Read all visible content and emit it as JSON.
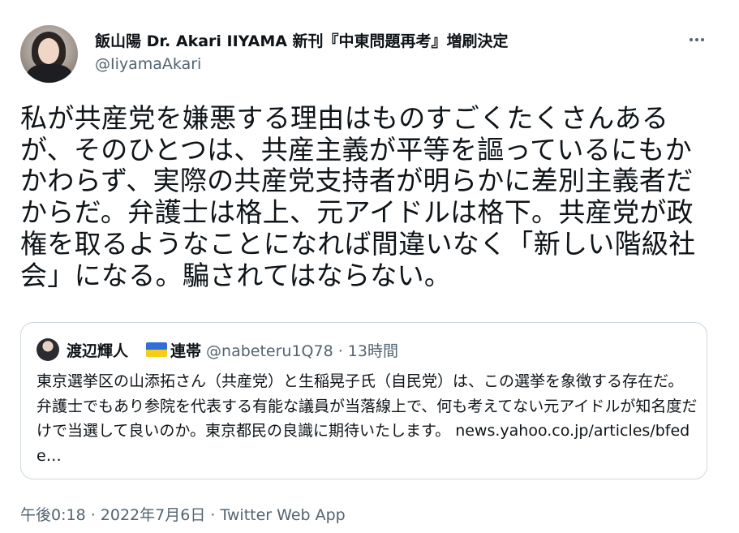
{
  "author": {
    "display_name": "飯山陽 Dr. Akari IIYAMA 新刊『中東問題再考』増刷決定",
    "handle": "@IiyamaAkari"
  },
  "tweet": {
    "text": "私が共産党を嫌悪する理由はものすごくたくさんあるが、そのひとつは、共産主義が平等を謳っているにもかかわらず、実際の共産党支持者が明らかに差別主義者だからだ。弁護士は格上、元アイドルは格下。共産党が政権を取るようなことになれば間違いなく「新しい階級社会」になる。騙されてはならない。"
  },
  "quoted": {
    "name": "渡辺輝人",
    "name_suffix": "連帯",
    "meta": "@nabeteru1Q78 · 13時間",
    "text": "東京選挙区の山添拓さん（共産党）と生稲晃子氏（自民党）は、この選挙を象徴する存在だ。弁護士でもあり参院を代表する有能な議員が当落線上で、何も考えてない元アイドルが知名度だけで当選して良いのか。東京都民の良識に期待いたします。",
    "link": "news.yahoo.co.jp/articles/bfede…"
  },
  "footer": {
    "timestamp": "午後0:18 · 2022年7月6日 · Twitter Web App"
  },
  "icons": {
    "more": "more-options-icon",
    "flag": "ukraine-flag-icon"
  },
  "colors": {
    "primary_text": "#0f1419",
    "secondary_text": "#536471",
    "border": "#cfd9de"
  }
}
